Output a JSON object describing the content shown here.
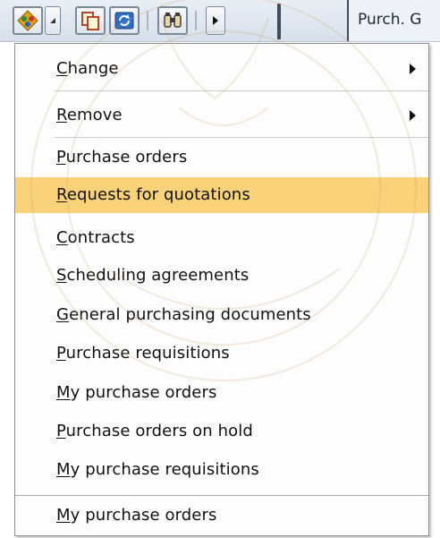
{
  "toolbar": {
    "title": "Purch. G",
    "icons": [
      "services-for-object-icon",
      "dropdown-arrow-icon",
      "copy-icon",
      "refresh-icon",
      "binoculars-icon",
      "next-page-icon"
    ]
  },
  "menu": {
    "items": [
      {
        "accel": "C",
        "rest": "hange",
        "submenu": true
      },
      {
        "accel": "R",
        "rest": "emove",
        "submenu": true
      },
      {
        "accel": "P",
        "rest": "urchase orders"
      },
      {
        "accel": "R",
        "rest": "equests for quotations",
        "highlighted": true
      },
      {
        "accel": "C",
        "rest": "ontracts"
      },
      {
        "accel": "S",
        "rest": "cheduling agreements"
      },
      {
        "accel": "G",
        "rest": "eneral purchasing documents"
      },
      {
        "accel": "P",
        "rest": "urchase requisitions"
      },
      {
        "accel": "M",
        "rest": "y purchase orders"
      },
      {
        "accel": "P",
        "rest": "urchase orders on hold"
      },
      {
        "accel": "M",
        "rest": "y purchase requisitions"
      },
      {
        "accel": "M",
        "rest": "y purchase orders"
      }
    ]
  },
  "colors": {
    "highlight": "#f9d27a",
    "menu_background": "#fdfdfd",
    "toolbar": "#dde5ee"
  }
}
